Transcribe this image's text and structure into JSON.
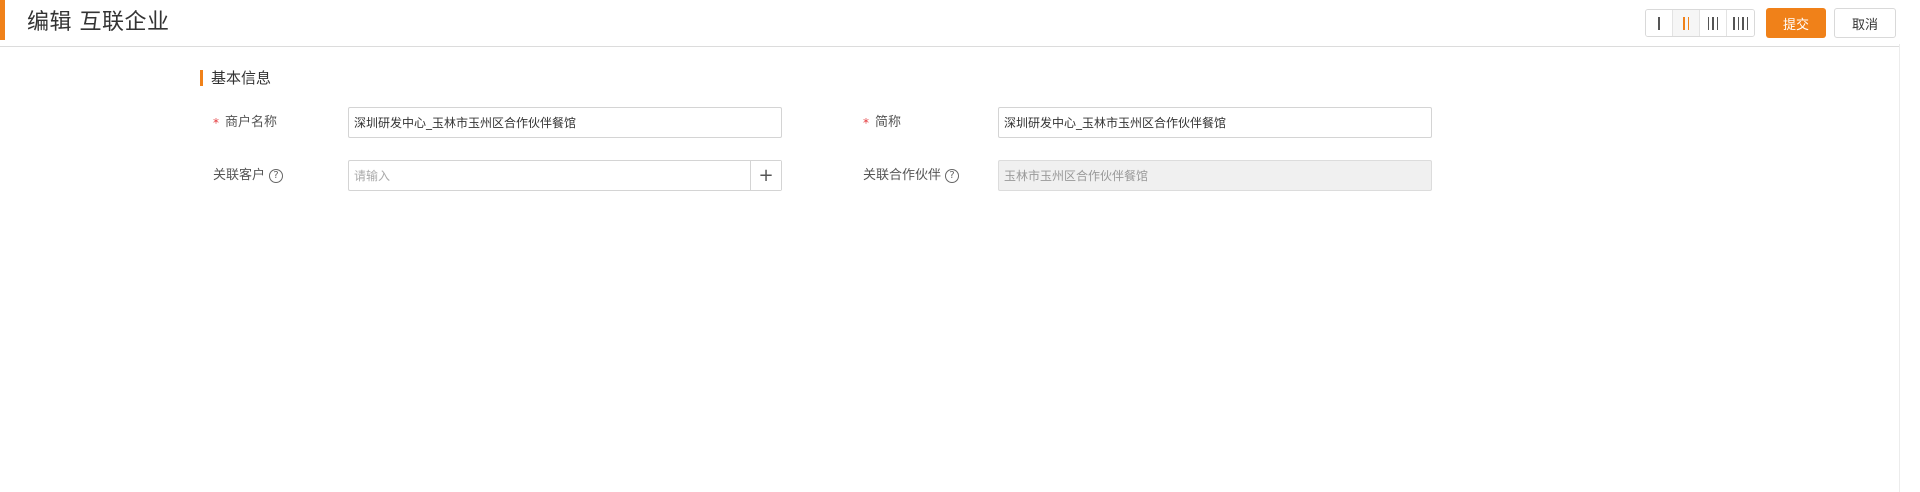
{
  "header": {
    "title": "编辑 互联企业",
    "submit_label": "提交",
    "cancel_label": "取消",
    "layout_options": [
      {
        "name": "one-column",
        "bars": 1,
        "active": false
      },
      {
        "name": "two-column",
        "bars": 2,
        "active": true
      },
      {
        "name": "three-column",
        "bars": 3,
        "active": false
      },
      {
        "name": "four-column",
        "bars": 4,
        "active": false
      }
    ]
  },
  "colors": {
    "accent": "#f08119",
    "required": "#e4393c"
  },
  "section": {
    "title": "基本信息"
  },
  "form": {
    "merchant_name": {
      "label": "商户名称",
      "required": true,
      "value": "深圳研发中心_玉林市玉州区合作伙伴餐馆"
    },
    "short_name": {
      "label": "简称",
      "required": true,
      "value": "深圳研发中心_玉林市玉州区合作伙伴餐馆"
    },
    "related_customer": {
      "label": "关联客户",
      "help_icon": "question-circle-icon",
      "placeholder": "请输入",
      "value": "",
      "add_icon": "plus-icon",
      "add_symbol": "+"
    },
    "related_partner": {
      "label": "关联合作伙伴",
      "help_icon": "question-circle-icon",
      "value": "玉林市玉州区合作伙伴餐馆",
      "disabled": true
    }
  }
}
